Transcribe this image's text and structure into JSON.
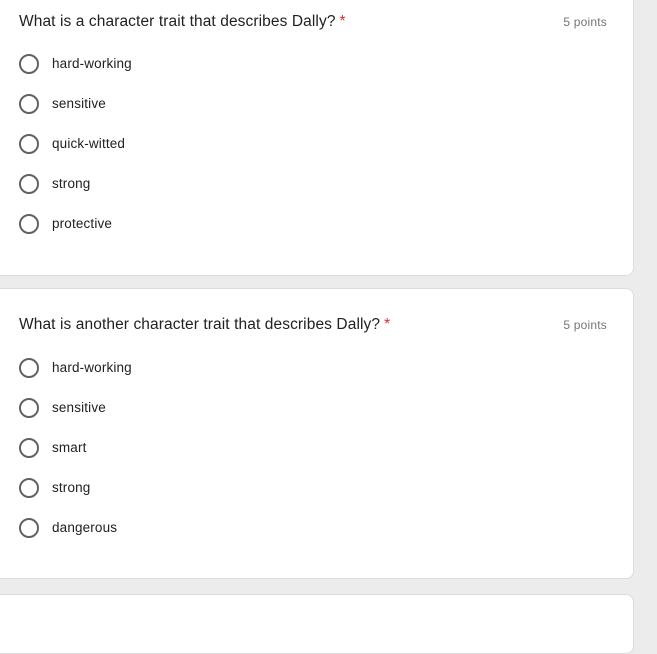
{
  "theme": {
    "page_background": "#ececec",
    "card_background": "#ffffff",
    "card_border": "#dadce0",
    "text_primary": "#202124",
    "text_secondary": "#70757a",
    "required_marker": "#d93025",
    "radio_border": "#5f6368"
  },
  "questions": [
    {
      "title": "What is a character trait that describes Dally?",
      "required_marker": "*",
      "points": "5 points",
      "options": [
        {
          "label": "hard-working",
          "selected": false
        },
        {
          "label": "sensitive",
          "selected": false
        },
        {
          "label": "quick-witted",
          "selected": false
        },
        {
          "label": "strong",
          "selected": false
        },
        {
          "label": "protective",
          "selected": false
        }
      ]
    },
    {
      "title": "What is another character trait that describes Dally?",
      "required_marker": "*",
      "points": "5 points",
      "options": [
        {
          "label": "hard-working",
          "selected": false
        },
        {
          "label": "sensitive",
          "selected": false
        },
        {
          "label": "smart",
          "selected": false
        },
        {
          "label": "strong",
          "selected": false
        },
        {
          "label": "dangerous",
          "selected": false
        }
      ]
    }
  ]
}
